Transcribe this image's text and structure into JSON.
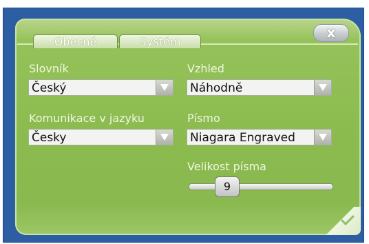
{
  "tabs": [
    {
      "label": "Obecné"
    },
    {
      "label": "Systém"
    }
  ],
  "close_label": "x",
  "fields": {
    "dictionary": {
      "label": "Slovník",
      "value": "Český"
    },
    "communication": {
      "label": "Komunikace v jazyku",
      "value": "Česky"
    },
    "appearance": {
      "label": "Vzhled",
      "value": "Náhodně"
    },
    "font": {
      "label": "Písmo",
      "value": "Niagara Engraved"
    },
    "font_size": {
      "label": "Velikost písma",
      "value": "9"
    }
  },
  "icons": {
    "close": "close-icon",
    "dropdown": "chevron-down-icon",
    "confirm": "checkmark-icon"
  }
}
